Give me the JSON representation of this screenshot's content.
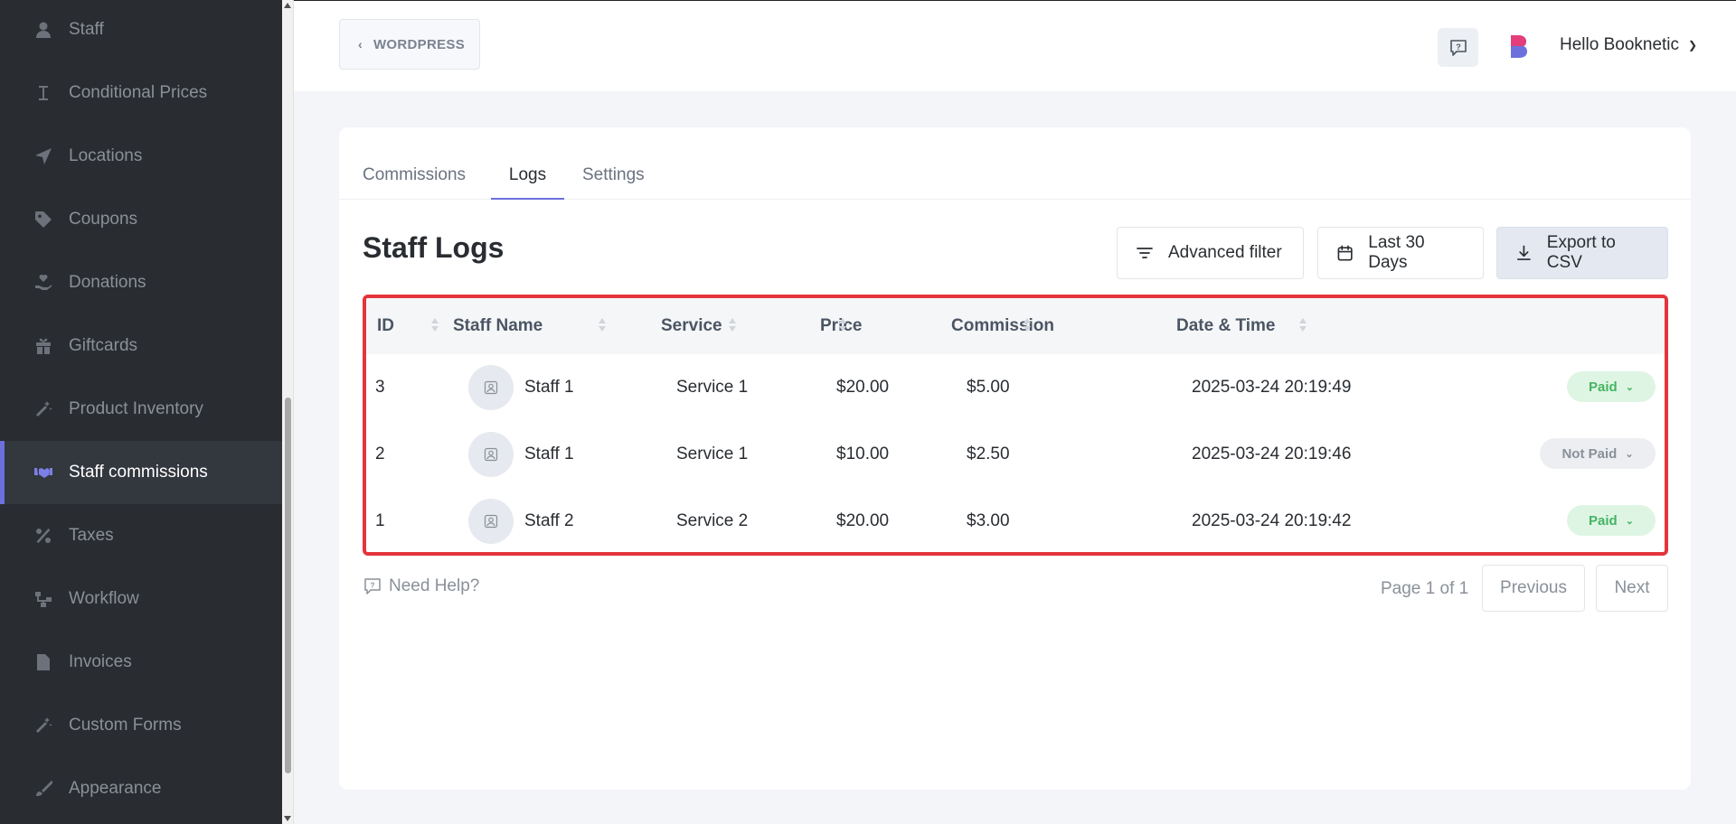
{
  "sidebar": {
    "items": [
      {
        "label": "Staff",
        "icon": "user-icon",
        "active": false
      },
      {
        "label": "Conditional Prices",
        "icon": "text-cursor-icon",
        "active": false
      },
      {
        "label": "Locations",
        "icon": "location-arrow-icon",
        "active": false
      },
      {
        "label": "Coupons",
        "icon": "tag-icon",
        "active": false
      },
      {
        "label": "Donations",
        "icon": "hand-heart-icon",
        "active": false
      },
      {
        "label": "Giftcards",
        "icon": "gift-icon",
        "active": false
      },
      {
        "label": "Product Inventory",
        "icon": "magic-wand-icon",
        "active": false
      },
      {
        "label": "Staff commissions",
        "icon": "handshake-icon",
        "active": true
      },
      {
        "label": "Taxes",
        "icon": "percent-icon",
        "active": false
      },
      {
        "label": "Workflow",
        "icon": "workflow-icon",
        "active": false
      },
      {
        "label": "Invoices",
        "icon": "document-icon",
        "active": false
      },
      {
        "label": "Custom Forms",
        "icon": "magic-wand-icon",
        "active": false
      },
      {
        "label": "Appearance",
        "icon": "brush-icon",
        "active": false
      }
    ]
  },
  "header": {
    "back_label": "WORDPRESS",
    "greeting": "Hello Booknetic"
  },
  "tabs": [
    {
      "label": "Commissions",
      "active": false
    },
    {
      "label": "Logs",
      "active": true
    },
    {
      "label": "Settings",
      "active": false
    }
  ],
  "page": {
    "title": "Staff Logs",
    "advanced_filter_label": "Advanced filter",
    "date_range_label": "Last 30 Days",
    "export_label": "Export to CSV"
  },
  "table": {
    "columns": [
      "ID",
      "Staff Name",
      "Service",
      "Price",
      "Commission",
      "Date & Time"
    ],
    "rows": [
      {
        "id": "3",
        "staff": "Staff 1",
        "service": "Service 1",
        "price": "$20.00",
        "commission": "$5.00",
        "datetime": "2025-03-24 20:19:49",
        "status": "Paid"
      },
      {
        "id": "2",
        "staff": "Staff 1",
        "service": "Service 1",
        "price": "$10.00",
        "commission": "$2.50",
        "datetime": "2025-03-24 20:19:46",
        "status": "Not Paid"
      },
      {
        "id": "1",
        "staff": "Staff 2",
        "service": "Service 2",
        "price": "$20.00",
        "commission": "$3.00",
        "datetime": "2025-03-24 20:19:42",
        "status": "Paid"
      }
    ]
  },
  "footer": {
    "help_label": "Need Help?",
    "page_info": "Page 1 of 1",
    "previous_label": "Previous",
    "next_label": "Next"
  },
  "colors": {
    "sidebar_bg": "#292d32",
    "accent": "#6c70dc",
    "highlight_border": "#e4343c",
    "paid_bg": "#dff5e4",
    "paid_text": "#46b463"
  }
}
